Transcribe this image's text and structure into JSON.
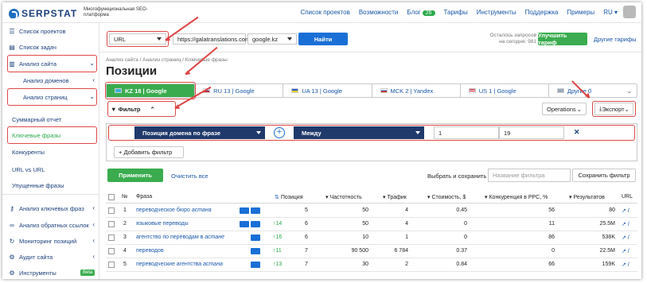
{
  "colors": {
    "brand": "#1a3f7a",
    "accent_green": "#3aac4f",
    "accent_blue": "#1a6fd6",
    "highlight_red": "#e04848",
    "dark_select": "#1f3a6b"
  },
  "header": {
    "logo": "SERPSTAT",
    "logo_sub": "Многофункциональная SEO-платформа",
    "nav": [
      "Список проектов",
      "Возможности",
      "Блог",
      "Тарифы",
      "Инструменты",
      "Поддержка",
      "Примеры"
    ],
    "blog_badge": "26",
    "lang": "RU"
  },
  "sidebar": {
    "items": [
      {
        "label": "Список проектов",
        "icon": "menu-icon"
      },
      {
        "label": "Список задач",
        "icon": "list-icon"
      },
      {
        "label": "Анализ сайта",
        "icon": "chart-icon"
      }
    ],
    "site_sub": [
      "Анализ доменов",
      "Анализ страниц"
    ],
    "pages_sub": [
      "Суммарный отчет",
      "Ключевые фразы",
      "Конкуренты",
      "URL vs URL",
      "Упущенные фразы"
    ],
    "bottom": [
      "Анализ ключевых фраз",
      "Анализ обратных ссылок",
      "Мониторинг позиций",
      "Аудит сайта",
      "Инструменты"
    ],
    "beta": "Beta"
  },
  "search": {
    "type": "URL",
    "query": "https://galatranslations.com",
    "engine": "google.kz",
    "find_button": "Найти",
    "remaining_line1": "Осталось запросов",
    "remaining_line2": "на сегодня: 981",
    "upgrade_button": "Улучшить тариф",
    "other_plans": "Другие тарифы"
  },
  "breadcrumb": "Анализ сайта / Анализ страниц / Ключевые фразы",
  "page_title": "Позиции",
  "db_tabs": [
    {
      "label": "KZ 18 | Google",
      "active": true
    },
    {
      "label": "RU 13 | Google"
    },
    {
      "label": "UA 13 | Google"
    },
    {
      "label": "MCK 2 | Yandex"
    },
    {
      "label": "US 1 | Google"
    },
    {
      "label": "Другие 0"
    }
  ],
  "filter": {
    "label": "Фильтр",
    "operations": "Operations",
    "export": "Экспорт",
    "field": "Позиция домена по фразе",
    "operator": "Между",
    "from": "1",
    "to": "19",
    "add_filter": "+ Добавить фильтр",
    "apply": "Применить",
    "clear": "Очистить все",
    "save_prompt": "Выбрать и сохранить",
    "filter_name_placeholder": "Название фильтра",
    "save_filter": "Сохранить фильтр"
  },
  "table": {
    "columns": [
      "№",
      "Фраза",
      "Позиция",
      "Частотность",
      "Трафик",
      "Стоимость, $",
      "Конкуренция в PPC, %",
      "Результатов",
      "URL"
    ],
    "rows": [
      {
        "n": "1",
        "phrase_a": "переводческое бюро ",
        "phrase_b": "астана",
        "change": "",
        "pos": "5",
        "freq": "50",
        "traffic": "4",
        "cost": "0.45",
        "comp": "56",
        "results": "80"
      },
      {
        "n": "2",
        "phrase_a": "языковые переводы",
        "phrase_b": "",
        "change": "14",
        "pos": "6",
        "freq": "50",
        "traffic": "4",
        "cost": "0",
        "comp": "11",
        "results": "25.5M"
      },
      {
        "n": "3",
        "phrase_a": "агентство по переводам в ",
        "phrase_b": "астане",
        "change": "16",
        "pos": "6",
        "freq": "10",
        "traffic": "1",
        "cost": "0",
        "comp": "86",
        "results": "538K"
      },
      {
        "n": "4",
        "phrase_a": "переводов",
        "phrase_b": "",
        "change": "11",
        "pos": "7",
        "freq": "90 500",
        "traffic": "6 784",
        "cost": "0.37",
        "comp": "0",
        "results": "22.5M"
      },
      {
        "n": "5",
        "phrase_a": "переводческие агентства ",
        "phrase_b": "астана",
        "change": "13",
        "pos": "7",
        "freq": "30",
        "traffic": "2",
        "cost": "0.84",
        "comp": "66",
        "results": "159K"
      }
    ]
  }
}
